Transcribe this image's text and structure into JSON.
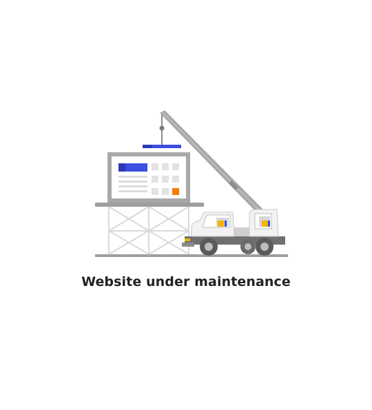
{
  "page": {
    "message": "Website under maintenance"
  },
  "illustration": {
    "icon": "construction-crane-icon",
    "colors": {
      "accent_blue": "#3B4FE0",
      "accent_orange": "#F57C00",
      "accent_yellow": "#F4B400",
      "steel_gray": "#9E9E9E",
      "light_gray": "#E0E0E0",
      "dark_gray": "#616161"
    }
  }
}
